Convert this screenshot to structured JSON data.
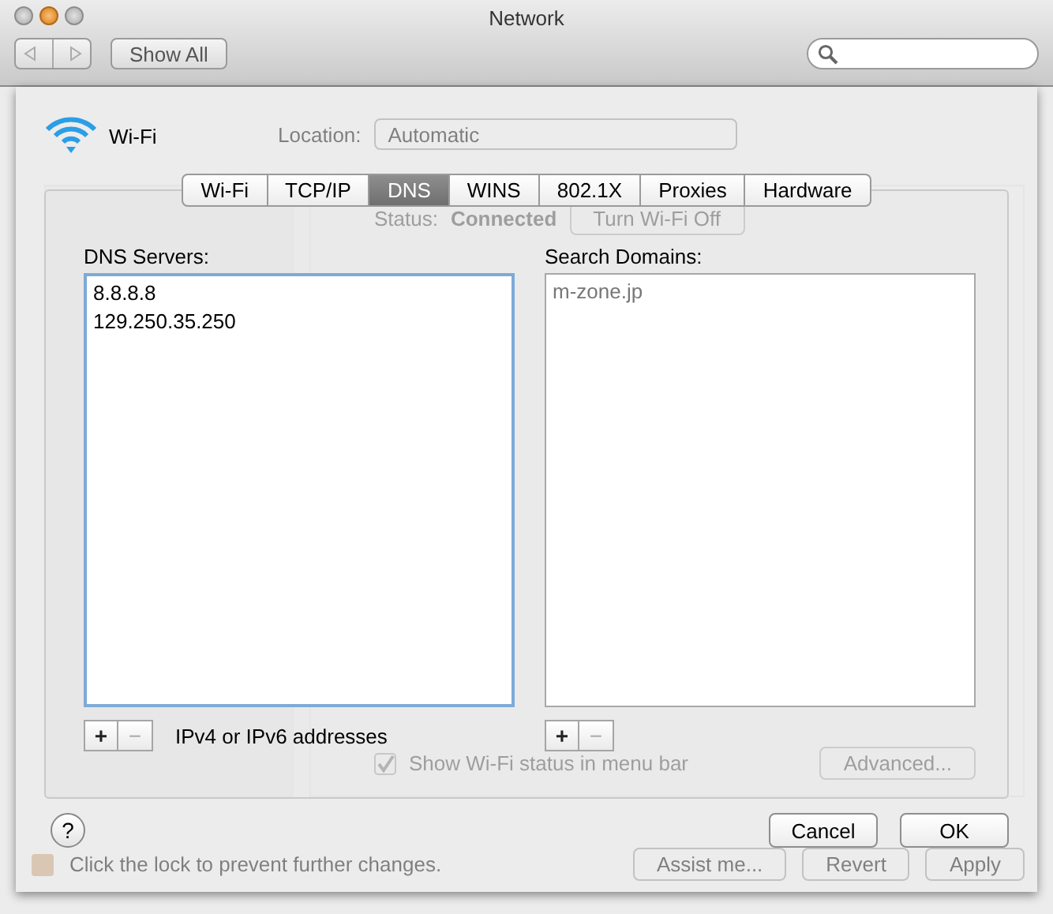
{
  "window": {
    "title": "Network"
  },
  "toolbar": {
    "show_all": "Show All"
  },
  "background": {
    "location_label": "Location:",
    "location_value": "Automatic",
    "status_label": "Status:",
    "status_value": "Connected",
    "turn_off_button": "Turn Wi-Fi Off",
    "show_status": {
      "label": "Show Wi-Fi status in menu bar",
      "checked": true
    },
    "advanced_button": "Advanced...",
    "lock_text": "Click the lock to prevent further changes.",
    "assist_button": "Assist me...",
    "revert_button": "Revert",
    "apply_button": "Apply"
  },
  "sheet": {
    "service": "Wi-Fi",
    "tabs": [
      {
        "label": "Wi-Fi",
        "selected": false
      },
      {
        "label": "TCP/IP",
        "selected": false
      },
      {
        "label": "DNS",
        "selected": true
      },
      {
        "label": "WINS",
        "selected": false
      },
      {
        "label": "802.1X",
        "selected": false
      },
      {
        "label": "Proxies",
        "selected": false
      },
      {
        "label": "Hardware",
        "selected": false
      }
    ],
    "dns_servers": {
      "label": "DNS Servers:",
      "focused": true,
      "entries": [
        {
          "text": "8.8.8.8",
          "kind": "manual"
        },
        {
          "text": "129.250.35.250",
          "kind": "manual"
        }
      ],
      "add": {
        "label": "+",
        "disabled": false
      },
      "remove": {
        "label": "−",
        "disabled": true
      },
      "hint": "IPv4 or IPv6 addresses"
    },
    "search_domains": {
      "label": "Search Domains:",
      "focused": false,
      "entries": [
        {
          "text": "m-zone.jp",
          "kind": "automatic"
        }
      ],
      "add": {
        "label": "+",
        "disabled": false
      },
      "remove": {
        "label": "−",
        "disabled": true
      }
    },
    "help": "?",
    "cancel": "Cancel",
    "ok": "OK"
  }
}
